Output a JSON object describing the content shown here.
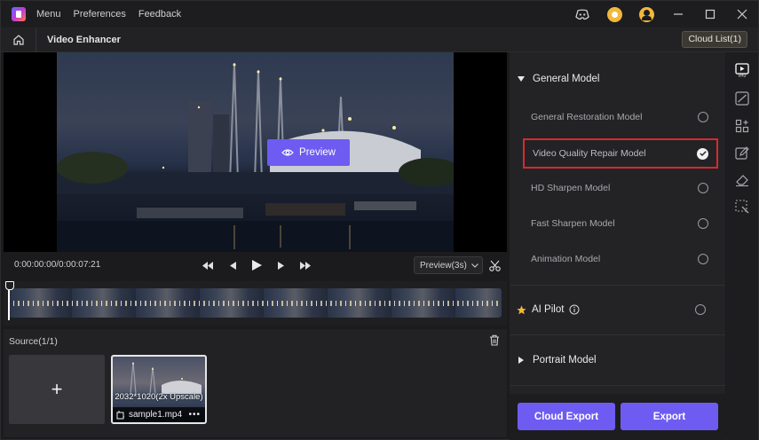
{
  "titlebar": {
    "menu": [
      "Menu",
      "Preferences",
      "Feedback"
    ]
  },
  "subbar": {
    "title": "Video Enhancer",
    "cloud_list": "Cloud List(1)"
  },
  "preview": {
    "button_label": "Preview"
  },
  "transport": {
    "timecode": "0:00:00:00/0:00:07:21",
    "preview_select": "Preview(3s)"
  },
  "source": {
    "title": "Source(1/1)",
    "add_label": "+",
    "clip": {
      "resolution": "2032*1020(2x Upscale)",
      "filename": "sample1.mp4",
      "more": "•••"
    }
  },
  "panel": {
    "general_model": "General Model",
    "models": [
      {
        "label": "General Restoration Model",
        "selected": false
      },
      {
        "label": "Video Quality Repair Model",
        "selected": true
      },
      {
        "label": "HD Sharpen Model",
        "selected": false
      },
      {
        "label": "Fast Sharpen Model",
        "selected": false
      },
      {
        "label": "Animation Model",
        "selected": false
      }
    ],
    "ai_pilot": "AI Pilot",
    "portrait_model": "Portrait Model",
    "cloud_export": "Cloud Export",
    "export": "Export"
  },
  "colors": {
    "accent": "#6e5cf2",
    "selected_border": "#d62a2f",
    "star": "#f2b83b"
  }
}
